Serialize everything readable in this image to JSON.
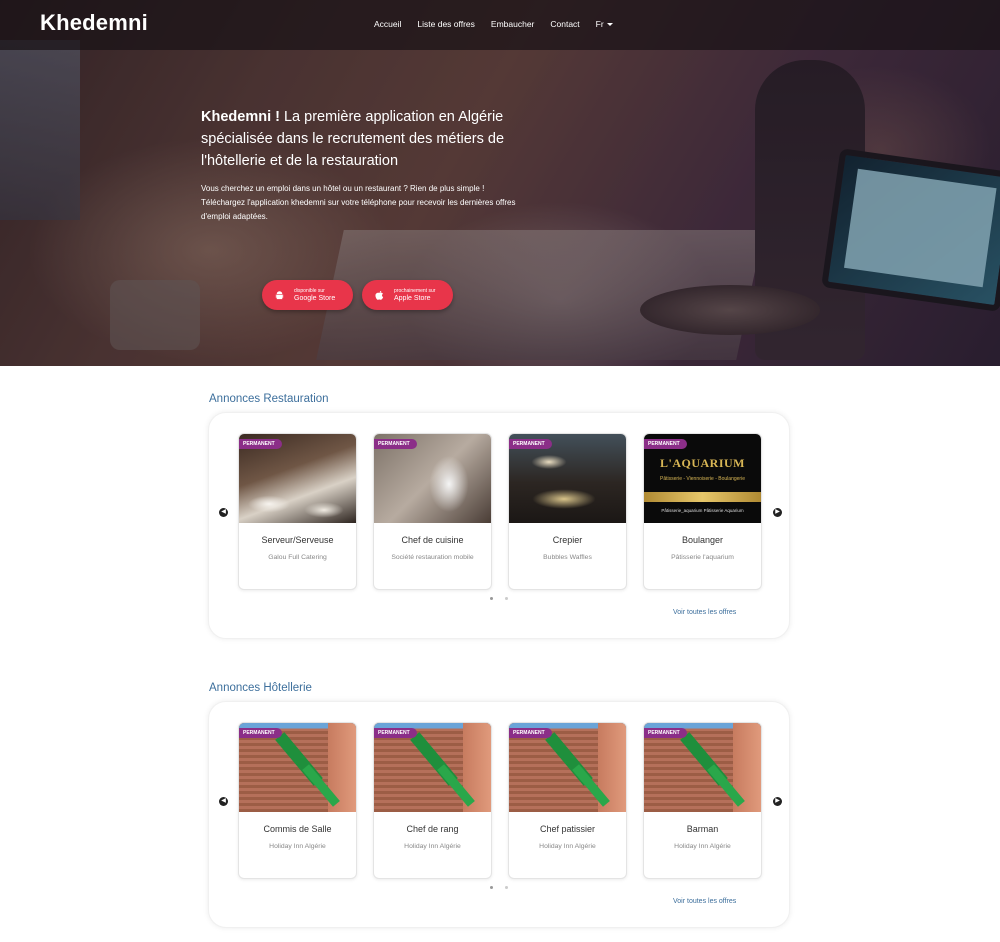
{
  "nav": {
    "logo": "Khedemni",
    "links": [
      "Accueil",
      "Liste des offres",
      "Embaucher",
      "Contact"
    ],
    "lang": "Fr"
  },
  "hero": {
    "title_bold": "Khedemni !",
    "title_rest": " La première application en Algérie spécialisée dans le recrutement des métiers de l'hôtellerie et de la restauration",
    "desc": "Vous cherchez un emploi dans un hôtel ou un restaurant ? Rien de plus simple ! Téléchargez l'application khedemni sur votre téléphone pour recevoir les dernières offres d'emploi adaptées.",
    "google": {
      "small": "disponible sur",
      "big": "Google Store"
    },
    "apple": {
      "small": "prochainement sur",
      "big": "Apple Store"
    }
  },
  "restauration": {
    "title": "Annonces Restauration",
    "see_all": "Voir toutes les offres",
    "cards": [
      {
        "badge": "PERMANENT",
        "title": "Serveur/Serveuse",
        "company": "Galou Full Catering"
      },
      {
        "badge": "PERMANENT",
        "title": "Chef de cuisine",
        "company": "Société restauration mobile"
      },
      {
        "badge": "PERMANENT",
        "title": "Crepier",
        "company": "Bubbles Waffles"
      },
      {
        "badge": "PERMANENT",
        "title": "Boulanger",
        "company": "Pâtisserie l'aquarium"
      }
    ],
    "aquarium_logo": {
      "name": "L'AQUARIUM",
      "tagline": "Pâtisserie - Viennoiserie - Boulangerie",
      "footer": "Pâtisserie_aquarium   Pâtisserie Aquarium"
    }
  },
  "hotellerie": {
    "title": "Annonces Hôtellerie",
    "see_all": "Voir toutes les offres",
    "cards": [
      {
        "badge": "PERMANENT",
        "title": "Commis de Salle",
        "company": "Holiday Inn Algérie"
      },
      {
        "badge": "PERMANENT",
        "title": "Chef de rang",
        "company": "Holiday Inn Algérie"
      },
      {
        "badge": "PERMANENT",
        "title": "Chef patissier",
        "company": "Holiday Inn Algérie"
      },
      {
        "badge": "PERMANENT",
        "title": "Barman",
        "company": "Holiday Inn Algérie"
      }
    ]
  },
  "colors": {
    "accent": "#3d6f9c",
    "badge": "#8b2e88",
    "store_button": "#e8354a"
  },
  "icons": {
    "prev": "chevron-left-icon",
    "next": "chevron-right-icon",
    "android": "android-icon",
    "apple": "apple-icon"
  }
}
